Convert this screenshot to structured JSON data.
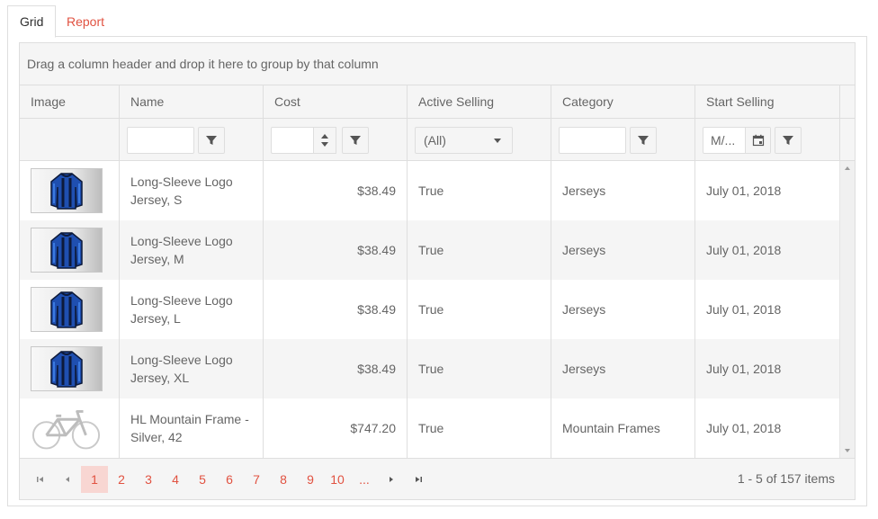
{
  "tabs": [
    {
      "label": "Grid",
      "active": true
    },
    {
      "label": "Report",
      "active": false
    }
  ],
  "grid": {
    "group_hint": "Drag a column header and drop it here to group by that column",
    "columns": [
      "Image",
      "Name",
      "Cost",
      "Active Selling",
      "Category",
      "Start Selling"
    ],
    "filters": {
      "name_value": "",
      "cost_value": "",
      "active_selected": "(All)",
      "category_value": "",
      "start_placeholder": "M/..."
    },
    "rows": [
      {
        "image": "jersey",
        "name": "Long-Sleeve Logo Jersey, S",
        "cost": "$38.49",
        "active": "True",
        "category": "Jerseys",
        "start": "July 01, 2018"
      },
      {
        "image": "jersey",
        "name": "Long-Sleeve Logo Jersey, M",
        "cost": "$38.49",
        "active": "True",
        "category": "Jerseys",
        "start": "July 01, 2018"
      },
      {
        "image": "jersey",
        "name": "Long-Sleeve Logo Jersey, L",
        "cost": "$38.49",
        "active": "True",
        "category": "Jerseys",
        "start": "July 01, 2018"
      },
      {
        "image": "jersey",
        "name": "Long-Sleeve Logo Jersey, XL",
        "cost": "$38.49",
        "active": "True",
        "category": "Jerseys",
        "start": "July 01, 2018"
      },
      {
        "image": "bike-frame",
        "name": "HL Mountain Frame - Silver, 42",
        "cost": "$747.20",
        "active": "True",
        "category": "Mountain Frames",
        "start": "July 01, 2018"
      }
    ]
  },
  "pager": {
    "pages": [
      "1",
      "2",
      "3",
      "4",
      "5",
      "6",
      "7",
      "8",
      "9",
      "10",
      "..."
    ],
    "current": "1",
    "info": "1 - 5 of 157 items"
  },
  "colors": {
    "accent": "#e15241",
    "active_page_bg": "#f8d6d2",
    "header_bg": "#f5f5f5",
    "border": "#dedede"
  },
  "icons": {
    "filter": "filter-icon",
    "calendar": "calendar-icon",
    "first": "seek-first-icon",
    "prev": "arrow-prev-icon",
    "next": "arrow-next-icon",
    "last": "seek-last-icon"
  }
}
